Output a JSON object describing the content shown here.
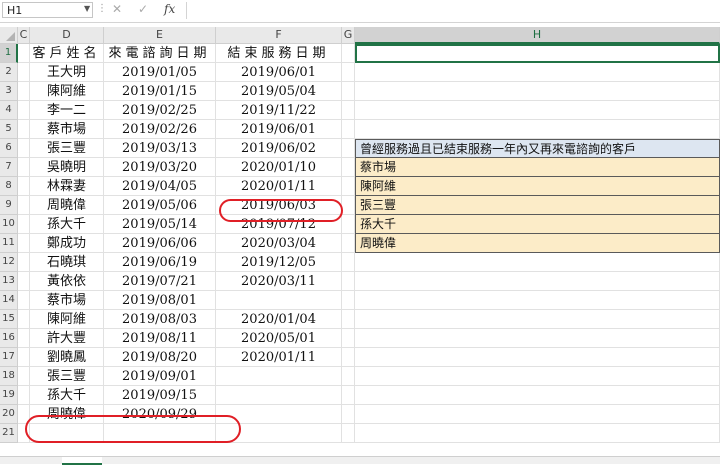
{
  "formula_bar": {
    "name_box": "H1",
    "cancel_icon": "✕",
    "enter_icon": "✓",
    "fx_label": "fx",
    "formula": ""
  },
  "columns": [
    "C",
    "D",
    "E",
    "F",
    "G",
    "H"
  ],
  "rows": [
    "1",
    "2",
    "3",
    "4",
    "5",
    "6",
    "7",
    "8",
    "9",
    "10",
    "11",
    "12",
    "13",
    "14",
    "15",
    "16",
    "17",
    "18",
    "19",
    "20",
    "21"
  ],
  "headers": {
    "customer_name": "客戶姓名",
    "call_date": "來電諮詢日期",
    "end_date": "結束服務日期"
  },
  "table": [
    {
      "name": "王大明",
      "call": "2019/01/05",
      "end": "2019/06/01"
    },
    {
      "name": "陳阿維",
      "call": "2019/01/15",
      "end": "2019/05/04"
    },
    {
      "name": "李一二",
      "call": "2019/02/25",
      "end": "2019/11/22"
    },
    {
      "name": "蔡市場",
      "call": "2019/02/26",
      "end": "2019/06/01"
    },
    {
      "name": "張三豐",
      "call": "2019/03/13",
      "end": "2019/06/02"
    },
    {
      "name": "吳曉明",
      "call": "2019/03/20",
      "end": "2020/01/10"
    },
    {
      "name": "林霖妻",
      "call": "2019/04/05",
      "end": "2020/01/11"
    },
    {
      "name": "周曉偉",
      "call": "2019/05/06",
      "end": "2019/06/03"
    },
    {
      "name": "孫大千",
      "call": "2019/05/14",
      "end": "2019/07/12"
    },
    {
      "name": "鄭成功",
      "call": "2019/06/06",
      "end": "2020/03/04"
    },
    {
      "name": "石曉琪",
      "call": "2019/06/19",
      "end": "2019/12/05"
    },
    {
      "name": "黃依依",
      "call": "2019/07/21",
      "end": "2020/03/11"
    },
    {
      "name": "蔡市場",
      "call": "2019/08/01",
      "end": ""
    },
    {
      "name": "陳阿維",
      "call": "2019/08/03",
      "end": "2020/01/04"
    },
    {
      "name": "許大豐",
      "call": "2019/08/11",
      "end": "2020/05/01"
    },
    {
      "name": "劉曉鳳",
      "call": "2019/08/20",
      "end": "2020/01/11"
    },
    {
      "name": "張三豐",
      "call": "2019/09/01",
      "end": ""
    },
    {
      "name": "孫大千",
      "call": "2019/09/15",
      "end": ""
    },
    {
      "name": "周曉偉",
      "call": "2020/09/29",
      "end": ""
    }
  ],
  "result": {
    "title": "曾經服務過且已結束服務一年內又再來電諮詢的客戶",
    "items": [
      "蔡市場",
      "陳阿維",
      "張三豐",
      "孫大千",
      "周曉偉"
    ]
  },
  "highlight_color": "#e01f26",
  "selection_color": "#217346"
}
